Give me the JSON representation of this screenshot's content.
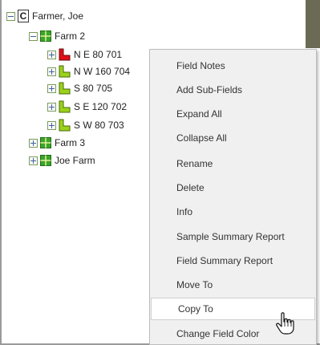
{
  "tree": {
    "root": {
      "label": "Farmer, Joe",
      "icon": "c-icon"
    },
    "farms": [
      {
        "label": "Farm 2",
        "expanded": true
      },
      {
        "label": "Farm 3",
        "expanded": false
      },
      {
        "label": "Joe Farm",
        "expanded": false
      }
    ],
    "fields": [
      {
        "label": "N E 80 701",
        "color": "#e0101a"
      },
      {
        "label": "N W 160 704",
        "color": "#9bd21a"
      },
      {
        "label": "S 80 705",
        "color": "#9bd21a"
      },
      {
        "label": "S E 120 702",
        "color": "#9bd21a"
      },
      {
        "label": "S W 80 703",
        "color": "#9bd21a"
      }
    ]
  },
  "context_menu": {
    "items": [
      {
        "label": "Field Notes"
      },
      {
        "label": "Add Sub-Fields"
      },
      {
        "label": "Expand All"
      },
      {
        "label": "Collapse All"
      },
      {
        "label": "Rename"
      },
      {
        "label": "Delete"
      },
      {
        "label": "Info"
      },
      {
        "label": "Sample Summary Report"
      },
      {
        "label": "Field Summary Report"
      },
      {
        "label": "Move To"
      },
      {
        "label": "Copy To",
        "hovered": true
      },
      {
        "label": "Change Field Color"
      }
    ]
  },
  "colors": {
    "farm_icon": "#3aa52a",
    "farm_icon_border": "#1f6a16"
  }
}
